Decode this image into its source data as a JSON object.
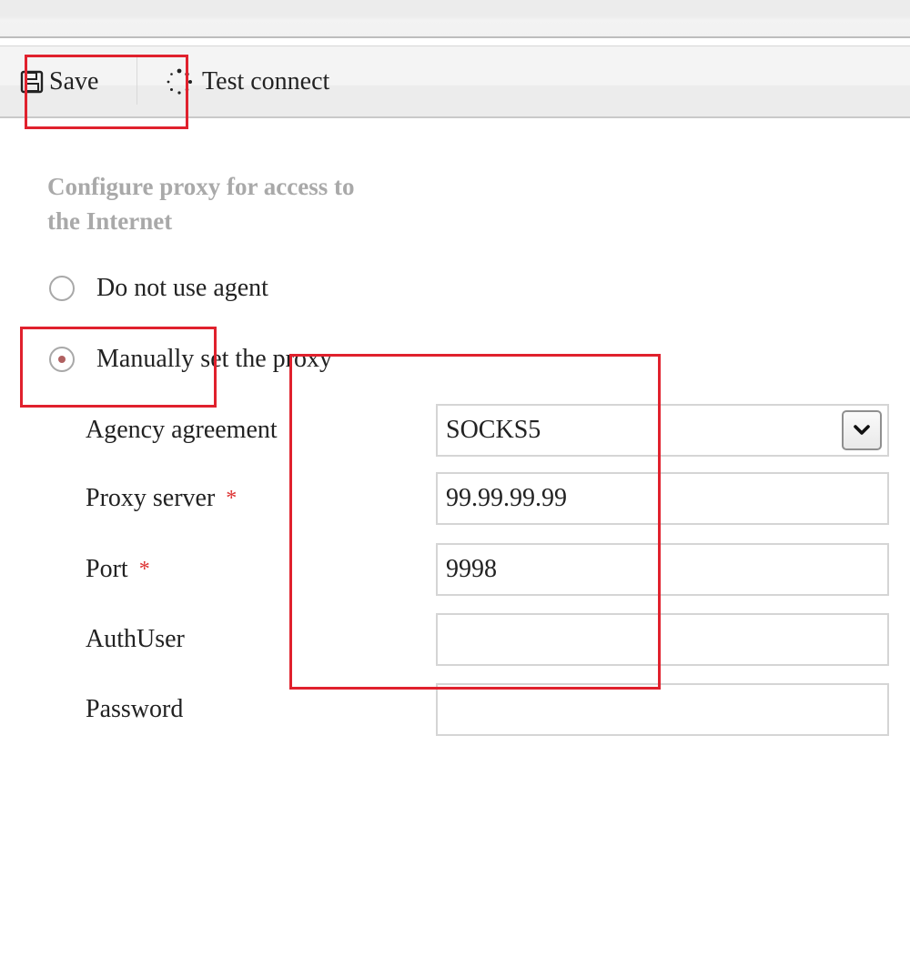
{
  "toolbar": {
    "save_label": "Save",
    "save_icon": "save-icon",
    "test_label": "Test connect",
    "test_icon": "spinner-icon"
  },
  "section_title": "Configure proxy for access to the Internet",
  "proxy_mode": {
    "options": [
      {
        "label": "Do not use agent",
        "checked": false
      },
      {
        "label": "Manually set the proxy",
        "checked": true
      }
    ]
  },
  "fields": {
    "agreement": {
      "label": "Agency agreement",
      "value": "SOCKS5"
    },
    "server": {
      "label": "Proxy server",
      "value": "99.99.99.99",
      "required": true
    },
    "port": {
      "label": "Port",
      "value": "9998",
      "required": true
    },
    "authuser": {
      "label": "AuthUser",
      "value": ""
    },
    "password": {
      "label": "Password",
      "value": ""
    }
  },
  "required_mark": "*",
  "colors": {
    "highlight": "#e0212d",
    "required": "#dd3333",
    "section_title": "#a9a9a9"
  }
}
